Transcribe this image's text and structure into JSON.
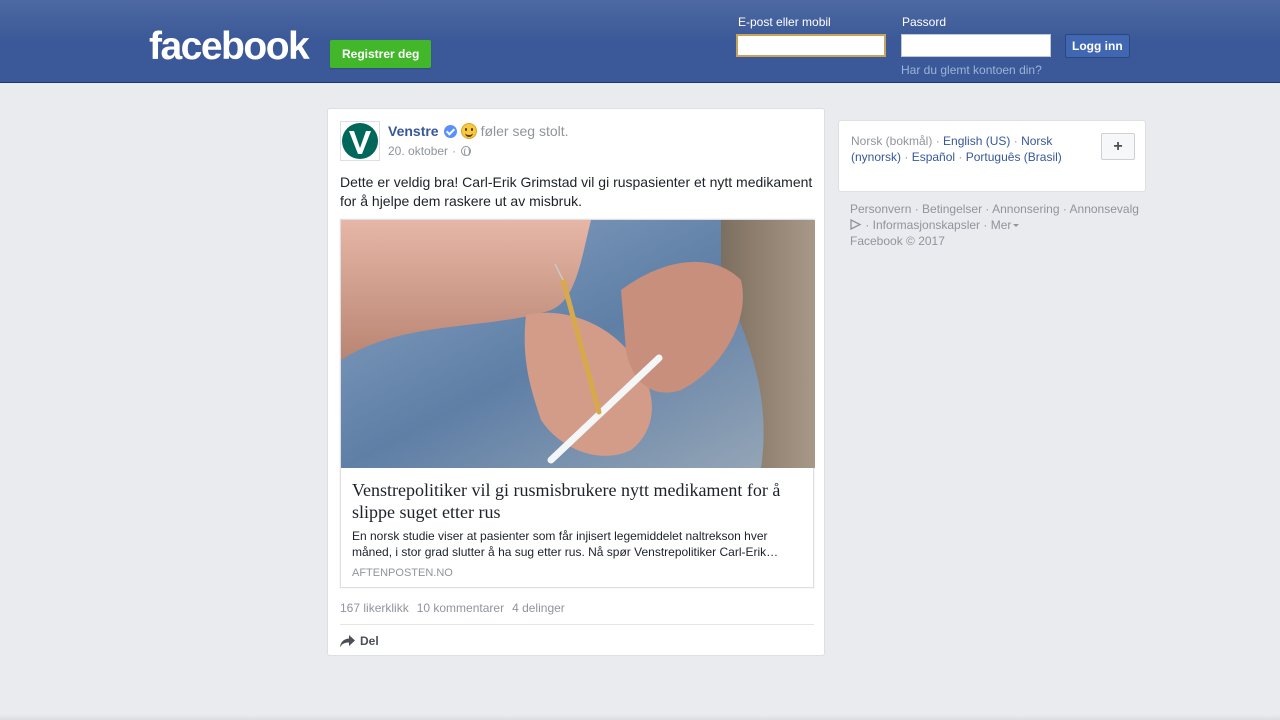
{
  "header": {
    "logo": "facebook",
    "register_label": "Registrer deg",
    "email_label": "E-post eller mobil",
    "password_label": "Passord",
    "email_value": "",
    "password_value": "",
    "login_label": "Logg inn",
    "forgot_label": "Har du glemt kontoen din?"
  },
  "post": {
    "author": "Venstre",
    "feeling": "føler seg stolt.",
    "date": "20. oktober",
    "separator": "·",
    "text": "Dette er veldig bra! Carl-Erik Grimstad vil gi ruspasienter et nytt medikament for å hjelpe dem raskere ut av misbruk.",
    "link": {
      "title": "Venstrepolitiker vil gi rusmisbrukere nytt medikament for å slippe suget etter rus",
      "description": "En norsk studie viser at pasienter som får injisert legemiddelet naltrekson hver måned, i stor grad slutter å ha sug etter rus. Nå spør Venstrepolitiker Carl-Erik…",
      "domain": "AFTENPOSTEN.NO"
    },
    "stats": {
      "likes": "167 likerklikk",
      "comments": "10 kommentarer",
      "shares": "4 delinger"
    },
    "share_label": "Del"
  },
  "languages": {
    "current": "Norsk (bokmål)",
    "items": [
      "English (US)",
      "Norsk (nynorsk)",
      "Español",
      "Português (Brasil)"
    ],
    "add_label": "+"
  },
  "footer": {
    "links": [
      "Personvern",
      "Betingelser",
      "Annonsering",
      "Annonsevalg",
      "Informasjonskapsler",
      "Mer"
    ],
    "copyright": "Facebook © 2017"
  },
  "colors": {
    "brand_blue": "#3b5998",
    "register_green": "#42b72a",
    "link_blue": "#365899",
    "muted_gray": "#90949c"
  }
}
